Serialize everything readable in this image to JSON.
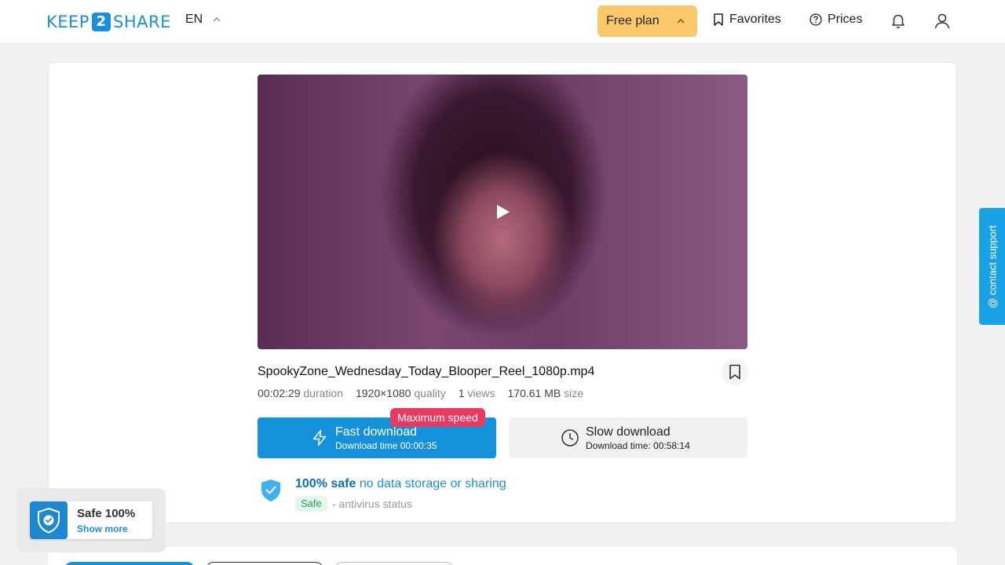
{
  "header": {
    "logo_left": "KEEP",
    "logo_number": "2",
    "logo_right": "SHARE",
    "language": "EN",
    "plan_label": "Free plan",
    "favorites_label": "Favorites",
    "prices_label": "Prices"
  },
  "file": {
    "name": "SpookyZone_Wednesday_Today_Blooper_Reel_1080p.mp4",
    "duration_value": "00:02:29",
    "duration_unit": "duration",
    "quality_value": "1920×1080",
    "quality_unit": "quality",
    "views_value": "1",
    "views_unit": "views",
    "size_value": "170.61 MB",
    "size_unit": "size"
  },
  "download": {
    "badge": "Maximum speed",
    "fast_title": "Fast download",
    "fast_time": "Download time 00:00:35",
    "slow_title": "Slow download",
    "slow_time": "Download time: 00:58:14"
  },
  "safety": {
    "headline_bold": "100% safe",
    "headline_rest": "no data storage or sharing",
    "tag": "Safe",
    "antivirus": "- antivirus status"
  },
  "safe_widget": {
    "title": "Safe 100%",
    "link": "Show more"
  },
  "support": {
    "label": "@ contact support"
  },
  "colors": {
    "brand": "#1a8fdc",
    "plan": "#fcc86a",
    "badge": "#e63a63"
  }
}
